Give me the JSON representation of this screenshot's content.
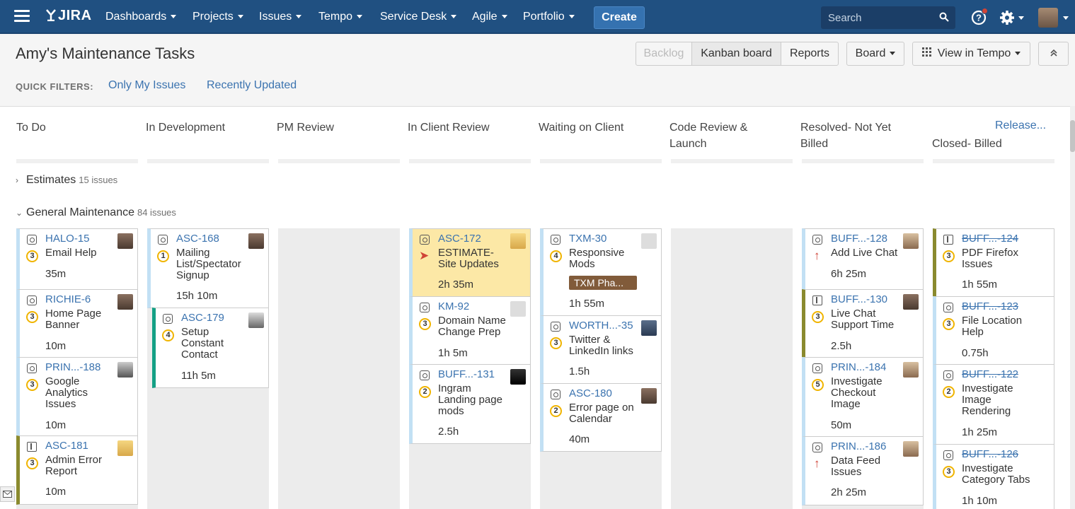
{
  "nav": {
    "logo": "JIRA",
    "items": [
      "Dashboards",
      "Projects",
      "Issues",
      "Tempo",
      "Service Desk",
      "Agile",
      "Portfolio"
    ],
    "create_label": "Create",
    "search_placeholder": "Search",
    "help_icon": "help-icon",
    "settings_icon": "gear-icon"
  },
  "header": {
    "title": "Amy's Maintenance Tasks",
    "buttons": {
      "backlog": "Backlog",
      "kanban": "Kanban board",
      "reports": "Reports",
      "board": "Board",
      "view_tempo": "View in Tempo"
    },
    "quick_filters_label": "QUICK FILTERS:",
    "quick_filters": [
      "Only My Issues",
      "Recently Updated"
    ]
  },
  "columns": {
    "todo": "To Do",
    "dev": "In Development",
    "pm": "PM Review",
    "client_review": "In Client Review",
    "waiting": "Waiting on Client",
    "code_review_1": "Code Review &",
    "code_review_2": "Launch",
    "resolved_1": "Resolved- Not Yet",
    "resolved_2": "Billed",
    "closed": "Closed- Billed",
    "release": "Release..."
  },
  "swimlanes": {
    "estimates": {
      "name": "Estimates",
      "count": "15 issues"
    },
    "general": {
      "name": "General Maintenance",
      "count": "84 issues"
    }
  },
  "cards": {
    "c1": {
      "key": "HALO-15",
      "prio": "3",
      "s1": "Email Help",
      "s2": "",
      "s3": "",
      "time": "35m"
    },
    "c2": {
      "key": "RICHIE-6",
      "prio": "3",
      "s1": "Home Page",
      "s2": "Banner",
      "s3": "",
      "time": "10m"
    },
    "c3": {
      "key": "PRIN...-188",
      "prio": "3",
      "s1": "Google",
      "s2": "Analytics",
      "s3": "Issues",
      "time": "10m"
    },
    "c4": {
      "key": "ASC-181",
      "prio": "3",
      "s1": "Admin Error",
      "s2": "Report",
      "s3": "",
      "time": "10m"
    },
    "c5": {
      "key": "ASC-168",
      "prio": "1",
      "s1": "Mailing",
      "s2": "List/Spectator",
      "s3": "Signup",
      "time": "15h 10m"
    },
    "c6": {
      "key": "ASC-179",
      "prio": "4",
      "s1": "Setup",
      "s2": "Constant",
      "s3": "Contact",
      "time": "11h 5m"
    },
    "c7": {
      "key": "ASC-172",
      "s1": "ESTIMATE-",
      "s2": "Site Updates",
      "s3": "",
      "time": "2h 35m"
    },
    "c8": {
      "key": "KM-92",
      "prio": "3",
      "s1": "Domain Name",
      "s2": "Change Prep",
      "s3": "",
      "time": "1h 5m"
    },
    "c9": {
      "key": "BUFF...-131",
      "prio": "2",
      "s1": "Ingram",
      "s2": "Landing page",
      "s3": "mods",
      "time": "2.5h"
    },
    "c10": {
      "key": "TXM-30",
      "prio": "4",
      "s1": "Responsive",
      "s2": "Mods",
      "s3": "",
      "epic": "TXM Pha...",
      "time": "1h 55m"
    },
    "c11": {
      "key": "WORTH...-35",
      "prio": "3",
      "s1": "Twitter &",
      "s2": "LinkedIn links",
      "s3": "",
      "time": "1.5h"
    },
    "c12": {
      "key": "ASC-180",
      "prio": "2",
      "s1": "Error page on",
      "s2": "Calendar",
      "s3": "",
      "time": "40m"
    },
    "c13": {
      "key": "BUFF...-128",
      "s1": "Add Live Chat",
      "s2": "",
      "s3": "",
      "time": "6h 25m"
    },
    "c14": {
      "key": "BUFF...-130",
      "prio": "3",
      "s1": "Live Chat",
      "s2": "Support Time",
      "s3": "",
      "time": "2.5h"
    },
    "c15": {
      "key": "PRIN...-184",
      "prio": "5",
      "s1": "Investigate",
      "s2": "Checkout",
      "s3": "Image",
      "time": "50m"
    },
    "c16": {
      "key": "PRIN...-186",
      "s1": "Data Feed",
      "s2": "Issues",
      "s3": "",
      "time": "2h 25m"
    },
    "c17": {
      "key": "BUFF...-124",
      "prio": "3",
      "s1": "PDF Firefox",
      "s2": "Issues",
      "s3": "",
      "time": "1h 55m"
    },
    "c18": {
      "key": "BUFF...-123",
      "prio": "3",
      "s1": "File Location",
      "s2": "Help",
      "s3": "",
      "time": "0.75h"
    },
    "c19": {
      "key": "BUFF...-122",
      "prio": "2",
      "s1": "Investigate",
      "s2": "Image",
      "s3": "Rendering",
      "time": "1h 25m"
    },
    "c20": {
      "key": "BUFF...-126",
      "prio": "3",
      "s1": "Investigate",
      "s2": "Category Tabs",
      "s3": "",
      "time": "1h 10m"
    }
  },
  "colors": {
    "nav": "#205081",
    "link": "#3b73af",
    "story": "#c2e0f4",
    "improvement": "#8a8a2e",
    "teal": "#14a085",
    "highlight": "#fce8a6",
    "priority_ring": "#f0b400"
  }
}
